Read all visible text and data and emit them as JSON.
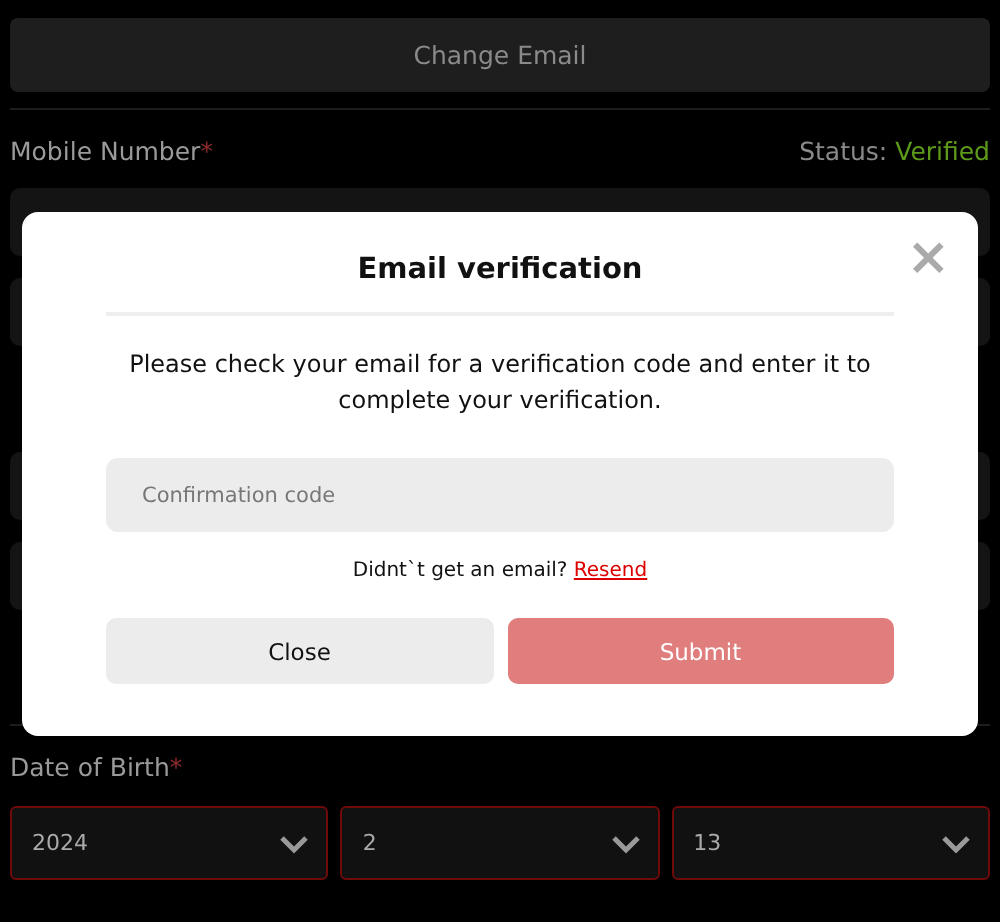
{
  "page": {
    "change_email_button": "Change Email",
    "mobile_label": "Mobile Number",
    "required_mark": "*",
    "status_label": "Status:",
    "status_value": "Verified",
    "dob_label": "Date of Birth",
    "dob_required_mark": "*",
    "dob_selects": [
      {
        "value": "2024",
        "invalid": true
      },
      {
        "value": "2",
        "invalid": true
      },
      {
        "value": "13",
        "invalid": true
      }
    ]
  },
  "modal": {
    "title": "Email verification",
    "close_icon": "×",
    "message": "Please check your email for a verification code and enter it to complete your verification.",
    "code_field": {
      "placeholder": "Confirmation code"
    },
    "resend_prompt": "Didnt`t get an email?",
    "resend_link": "Resend",
    "buttons": [
      {
        "label": "Close",
        "kind": "secondary",
        "disabled": false
      },
      {
        "label": "Submit",
        "kind": "primary",
        "disabled": true
      }
    ]
  }
}
